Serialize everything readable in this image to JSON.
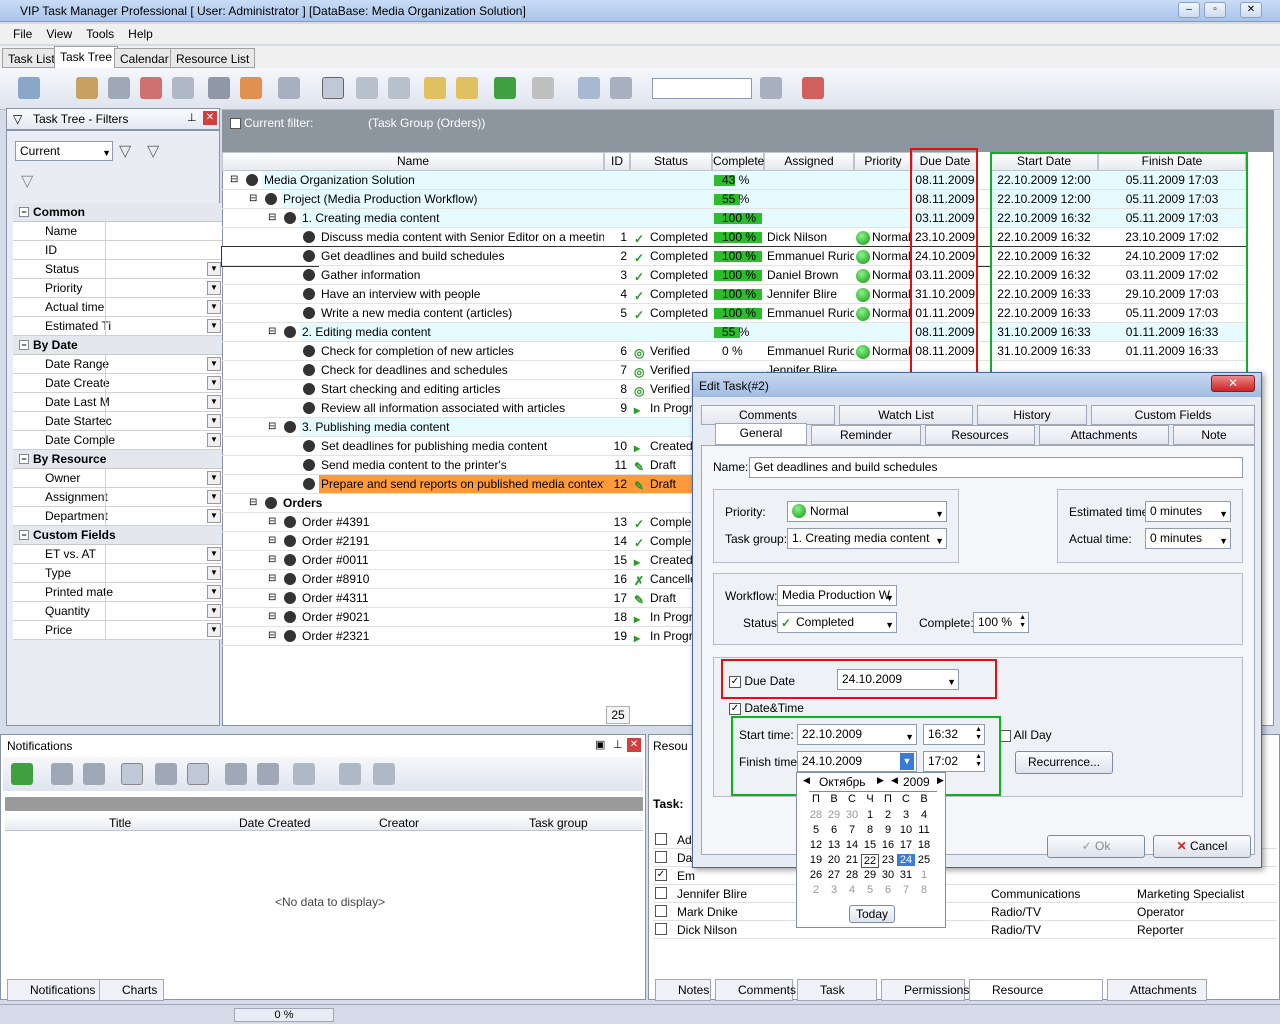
{
  "app": {
    "title": "VIP Task Manager Professional [ User: Administrator ] [DataBase: Media Organization Solution]"
  },
  "menu": [
    "File",
    "View",
    "Tools",
    "Help"
  ],
  "tabs": [
    "Task List",
    "Task Tree",
    "Calendar",
    "Resource List"
  ],
  "left": {
    "title": "Task Tree - Filters",
    "filter": "Current",
    "cats": [
      {
        "name": "Common",
        "items": [
          {
            "k": "Name",
            "dd": false
          },
          {
            "k": "ID",
            "dd": false
          },
          {
            "k": "Status",
            "dd": true
          },
          {
            "k": "Priority",
            "dd": true
          },
          {
            "k": "Actual time",
            "dd": true
          },
          {
            "k": "Estimated Ti",
            "dd": true
          }
        ]
      },
      {
        "name": "By Date",
        "items": [
          {
            "k": "Date Range",
            "dd": true
          },
          {
            "k": "Date Create",
            "dd": true
          },
          {
            "k": "Date Last M",
            "dd": true
          },
          {
            "k": "Date Startec",
            "dd": true
          },
          {
            "k": "Date Comple",
            "dd": true
          }
        ]
      },
      {
        "name": "By Resource",
        "items": [
          {
            "k": "Owner",
            "dd": true
          },
          {
            "k": "Assignment",
            "dd": true
          },
          {
            "k": "Department",
            "dd": true
          }
        ]
      },
      {
        "name": "Custom Fields",
        "items": [
          {
            "k": "ET vs. AT",
            "dd": true
          },
          {
            "k": "Type",
            "dd": true
          },
          {
            "k": "Printed mate",
            "dd": true
          },
          {
            "k": "Quantity",
            "dd": true
          },
          {
            "k": "Price",
            "dd": true
          }
        ]
      }
    ]
  },
  "filter": {
    "label": "Current filter:",
    "value": "(Task Group  (Orders))"
  },
  "grid": {
    "headers": [
      "Name",
      "ID",
      "Status",
      "Complete",
      "Assigned",
      "Priority",
      "Due Date",
      "Start Date",
      "Finish Date"
    ],
    "rows": [
      {
        "name": "Media Organization Solution",
        "lvl": 0,
        "id": "",
        "status": "",
        "complete": "43 %",
        "pct": 43,
        "assigned": "",
        "prio": "",
        "due": "08.11.2009",
        "start": "22.10.2009 12:00",
        "finish": "05.11.2009 17:03",
        "bg": "#e6fbff"
      },
      {
        "name": "Project (Media Production Workflow)",
        "lvl": 1,
        "id": "",
        "status": "",
        "complete": "55 %",
        "pct": 55,
        "assigned": "",
        "prio": "",
        "due": "08.11.2009",
        "start": "22.10.2009 12:00",
        "finish": "05.11.2009 17:03",
        "bg": "#e6fbff"
      },
      {
        "name": "1. Creating media content",
        "lvl": 2,
        "id": "",
        "status": "",
        "complete": "100 %",
        "pct": 100,
        "assigned": "",
        "prio": "",
        "due": "03.11.2009",
        "start": "22.10.2009 16:32",
        "finish": "05.11.2009 17:03",
        "bg": "#e6fbff"
      },
      {
        "name": "Discuss media content with Senior Editor on a meeting",
        "lvl": 3,
        "id": "1",
        "status": "Completed",
        "complete": "100 %",
        "pct": 100,
        "assigned": "Dick Nilson",
        "prio": "Normal",
        "due": "23.10.2009",
        "start": "22.10.2009 16:32",
        "finish": "23.10.2009 17:02",
        "bg": "#fff"
      },
      {
        "name": "Get deadlines and build schedules",
        "lvl": 3,
        "id": "2",
        "status": "Completed",
        "complete": "100 %",
        "pct": 100,
        "assigned": "Emmanuel Rurich",
        "prio": "Normal",
        "due": "24.10.2009",
        "start": "22.10.2009 16:32",
        "finish": "24.10.2009 17:02",
        "bg": "#fff",
        "sel": true
      },
      {
        "name": "Gather information",
        "lvl": 3,
        "id": "3",
        "status": "Completed",
        "complete": "100 %",
        "pct": 100,
        "assigned": "Daniel Brown",
        "prio": "Normal",
        "due": "03.11.2009",
        "start": "22.10.2009 16:32",
        "finish": "03.11.2009 17:02",
        "bg": "#fff"
      },
      {
        "name": "Have an interview with people",
        "lvl": 3,
        "id": "4",
        "status": "Completed",
        "complete": "100 %",
        "pct": 100,
        "assigned": "Jennifer Blire",
        "prio": "Normal",
        "due": "31.10.2009",
        "start": "22.10.2009 16:33",
        "finish": "29.10.2009 17:03",
        "bg": "#fff"
      },
      {
        "name": "Write a new media content (articles)",
        "lvl": 3,
        "id": "5",
        "status": "Completed",
        "complete": "100 %",
        "pct": 100,
        "assigned": "Emmanuel Rurich",
        "prio": "Normal",
        "due": "01.11.2009",
        "start": "22.10.2009 16:33",
        "finish": "05.11.2009 17:03",
        "bg": "#fff"
      },
      {
        "name": "2. Editing media content",
        "lvl": 2,
        "id": "",
        "status": "",
        "complete": "55 %",
        "pct": 55,
        "assigned": "",
        "prio": "",
        "due": "08.11.2009",
        "start": "31.10.2009 16:33",
        "finish": "01.11.2009 16:33",
        "bg": "#e6fbff"
      },
      {
        "name": "Check for completion of new articles",
        "lvl": 3,
        "id": "6",
        "status": "Verified",
        "complete": "0 %",
        "pct": 0,
        "assigned": "Emmanuel Rurich",
        "prio": "Normal",
        "due": "08.11.2009",
        "start": "31.10.2009 16:33",
        "finish": "01.11.2009 16:33",
        "bg": "#fff"
      },
      {
        "name": "Check for deadlines and schedules",
        "lvl": 3,
        "id": "7",
        "status": "Verified",
        "complete": "",
        "pct": 0,
        "assigned": "Jennifer Blire",
        "prio": "",
        "due": "",
        "start": "",
        "finish": "",
        "bg": "#fff"
      },
      {
        "name": "Start checking and editing articles",
        "lvl": 3,
        "id": "8",
        "status": "Verified",
        "complete": "",
        "pct": 0,
        "assigned": "",
        "prio": "",
        "due": "",
        "start": "",
        "finish": "",
        "bg": "#fff"
      },
      {
        "name": "Review all information associated with articles",
        "lvl": 3,
        "id": "9",
        "status": "In Progr",
        "complete": "",
        "pct": 0,
        "assigned": "",
        "prio": "",
        "due": "",
        "start": "",
        "finish": "",
        "bg": "#fff"
      },
      {
        "name": "3. Publishing media content",
        "lvl": 2,
        "id": "",
        "status": "",
        "complete": "",
        "pct": 0,
        "assigned": "",
        "prio": "",
        "due": "",
        "start": "",
        "finish": "",
        "bg": "#e6fbff"
      },
      {
        "name": "Set deadlines for publishing media content",
        "lvl": 3,
        "id": "10",
        "status": "Created",
        "complete": "",
        "pct": 0,
        "assigned": "",
        "prio": "",
        "due": "",
        "start": "",
        "finish": "",
        "bg": "#fff"
      },
      {
        "name": "Send media content to the printer's",
        "lvl": 3,
        "id": "11",
        "status": "Draft",
        "complete": "",
        "pct": 0,
        "assigned": "",
        "prio": "",
        "due": "",
        "start": "",
        "finish": "",
        "bg": "#fff"
      },
      {
        "name": "Prepare and send reports on published media context to ma",
        "lvl": 3,
        "id": "12",
        "status": "Draft",
        "complete": "",
        "pct": 0,
        "assigned": "",
        "prio": "",
        "due": "",
        "start": "",
        "finish": "",
        "bg": "#ff9a3c"
      },
      {
        "name": "Orders",
        "lvl": 1,
        "id": "",
        "status": "",
        "complete": "",
        "pct": 0,
        "assigned": "",
        "prio": "",
        "due": "",
        "start": "",
        "finish": "",
        "bg": "#fff",
        "bold": true
      },
      {
        "name": "Order #4391",
        "lvl": 2,
        "id": "13",
        "status": "Comple",
        "complete": "",
        "pct": 0,
        "assigned": "",
        "prio": "",
        "due": "",
        "start": "",
        "finish": "",
        "bg": "#fff"
      },
      {
        "name": "Order #2191",
        "lvl": 2,
        "id": "14",
        "status": "Comple",
        "complete": "",
        "pct": 0,
        "assigned": "",
        "prio": "",
        "due": "",
        "start": "",
        "finish": "",
        "bg": "#fff"
      },
      {
        "name": "Order #0011",
        "lvl": 2,
        "id": "15",
        "status": "Created",
        "complete": "",
        "pct": 0,
        "assigned": "",
        "prio": "",
        "due": "",
        "start": "",
        "finish": "",
        "bg": "#fff"
      },
      {
        "name": "Order #8910",
        "lvl": 2,
        "id": "16",
        "status": "Cancelle",
        "complete": "",
        "pct": 0,
        "assigned": "",
        "prio": "",
        "due": "",
        "start": "",
        "finish": "",
        "bg": "#fff"
      },
      {
        "name": "Order #4311",
        "lvl": 2,
        "id": "17",
        "status": "Draft",
        "complete": "",
        "pct": 0,
        "assigned": "",
        "prio": "",
        "due": "",
        "start": "",
        "finish": "",
        "bg": "#fff"
      },
      {
        "name": "Order #9021",
        "lvl": 2,
        "id": "18",
        "status": "In Progr",
        "complete": "",
        "pct": 0,
        "assigned": "",
        "prio": "",
        "due": "",
        "start": "",
        "finish": "",
        "bg": "#fff"
      },
      {
        "name": "Order #2321",
        "lvl": 2,
        "id": "19",
        "status": "In Progr",
        "complete": "",
        "pct": 0,
        "assigned": "",
        "prio": "",
        "due": "",
        "start": "",
        "finish": "",
        "bg": "#fff"
      }
    ],
    "count": "25"
  },
  "notifications": {
    "title": "Notifications",
    "cols": [
      "Title",
      "Date Created",
      "Creator",
      "Task group"
    ],
    "empty": "<No data to display>",
    "tabs": [
      "Notifications",
      "Charts"
    ]
  },
  "resources": {
    "title": "Resou",
    "task_label": "Task: ",
    "rows": [
      {
        "check": false,
        "name": "Ad",
        "dept": "",
        "pos": ""
      },
      {
        "check": false,
        "name": "Da",
        "dept": "",
        "pos": ""
      },
      {
        "check": true,
        "name": "Em",
        "dept": "",
        "pos": ""
      },
      {
        "check": false,
        "name": "Jennifer Blire",
        "dept": "Communications",
        "pos": "Marketing Specialist"
      },
      {
        "check": false,
        "name": "Mark Dnike",
        "dept": "Radio/TV",
        "pos": "Operator"
      },
      {
        "check": false,
        "name": "Dick Nilson",
        "dept": "Radio/TV",
        "pos": "Reporter"
      }
    ],
    "tabs": [
      "Notes",
      "Comments",
      "Task history",
      "Permissions",
      "Resource Assignment",
      "Attachments"
    ]
  },
  "dialog": {
    "title": "Edit Task(#2)",
    "tabs_top": [
      "Comments",
      "Watch List",
      "History",
      "Custom Fields"
    ],
    "tabs_bottom": [
      "General",
      "Reminder",
      "Resources",
      "Attachments",
      "Note"
    ],
    "name_label": "Name:",
    "name_value": "Get deadlines and build schedules",
    "priority_label": "Priority:",
    "priority": "Normal",
    "taskgroup_label": "Task group:",
    "taskgroup": "1. Creating media content",
    "est_label": "Estimated time:",
    "est": "0 minutes",
    "act_label": "Actual time:",
    "act": "0 minutes",
    "workflow_label": "Workflow:",
    "workflow": "Media Production W",
    "status_label": "Status:",
    "status": "Completed",
    "complete_label": "Complete:",
    "complete": "100 %",
    "due_label": "Due Date",
    "due": "24.10.2009",
    "datetime_label": "Date&Time",
    "start_label": "Start time:",
    "start_date": "22.10.2009",
    "start_time": "16:32",
    "finish_label": "Finish time:",
    "finish_date": "24.10.2009",
    "finish_time": "17:02",
    "allday_label": "All Day",
    "recurrence": "Recurrence...",
    "ok": "Ok",
    "cancel": "Cancel",
    "cal": {
      "month": "Октябрь",
      "year": "2009",
      "dow": [
        "П",
        "В",
        "С",
        "Ч",
        "П",
        "С",
        "В"
      ],
      "weeks": [
        [
          "28",
          "29",
          "30",
          "1",
          "2",
          "3",
          "4"
        ],
        [
          "5",
          "6",
          "7",
          "8",
          "9",
          "10",
          "11"
        ],
        [
          "12",
          "13",
          "14",
          "15",
          "16",
          "17",
          "18"
        ],
        [
          "19",
          "20",
          "21",
          "22",
          "23",
          "24",
          "25"
        ],
        [
          "26",
          "27",
          "28",
          "29",
          "30",
          "31",
          "1"
        ],
        [
          "2",
          "3",
          "4",
          "5",
          "6",
          "7",
          "8"
        ]
      ],
      "today": "Today"
    }
  },
  "status": {
    "progress": "0 %"
  },
  "colors": {
    "red": "#e01010",
    "green": "#10b020",
    "selected": "#ff9a3c"
  }
}
